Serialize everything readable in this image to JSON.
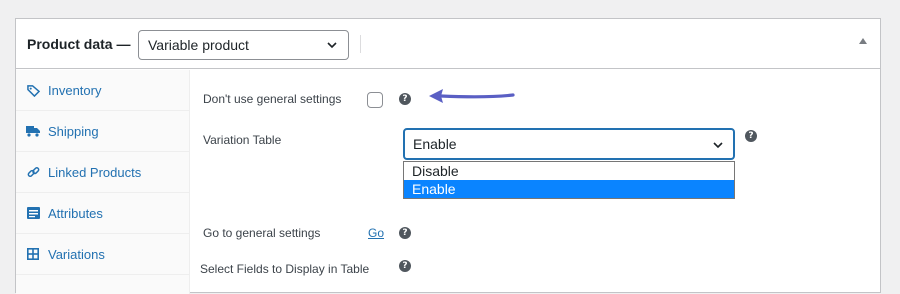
{
  "header": {
    "title": "Product data —",
    "product_type": "Variable product"
  },
  "sidebar": {
    "items": [
      {
        "label": "Inventory",
        "icon": "tag-icon"
      },
      {
        "label": "Shipping",
        "icon": "truck-icon"
      },
      {
        "label": "Linked Products",
        "icon": "link-icon"
      },
      {
        "label": "Attributes",
        "icon": "list-icon"
      },
      {
        "label": "Variations",
        "icon": "grid-icon"
      }
    ]
  },
  "fields": {
    "general_settings": {
      "label": "Don't use general settings",
      "checked": false,
      "help": "?"
    },
    "variation_table": {
      "label": "Variation Table",
      "value": "Enable",
      "options": [
        "Disable",
        "Enable"
      ],
      "selected": "Enable",
      "help": "?"
    },
    "go_general": {
      "label": "Go to general settings",
      "link": "Go",
      "help": "?"
    },
    "select_fields": {
      "label": "Select Fields to Display in Table",
      "help": "?"
    }
  },
  "colors": {
    "accent": "#2271b1",
    "arrow": "#5a5fc4",
    "selected_option": "#0a84ff"
  }
}
